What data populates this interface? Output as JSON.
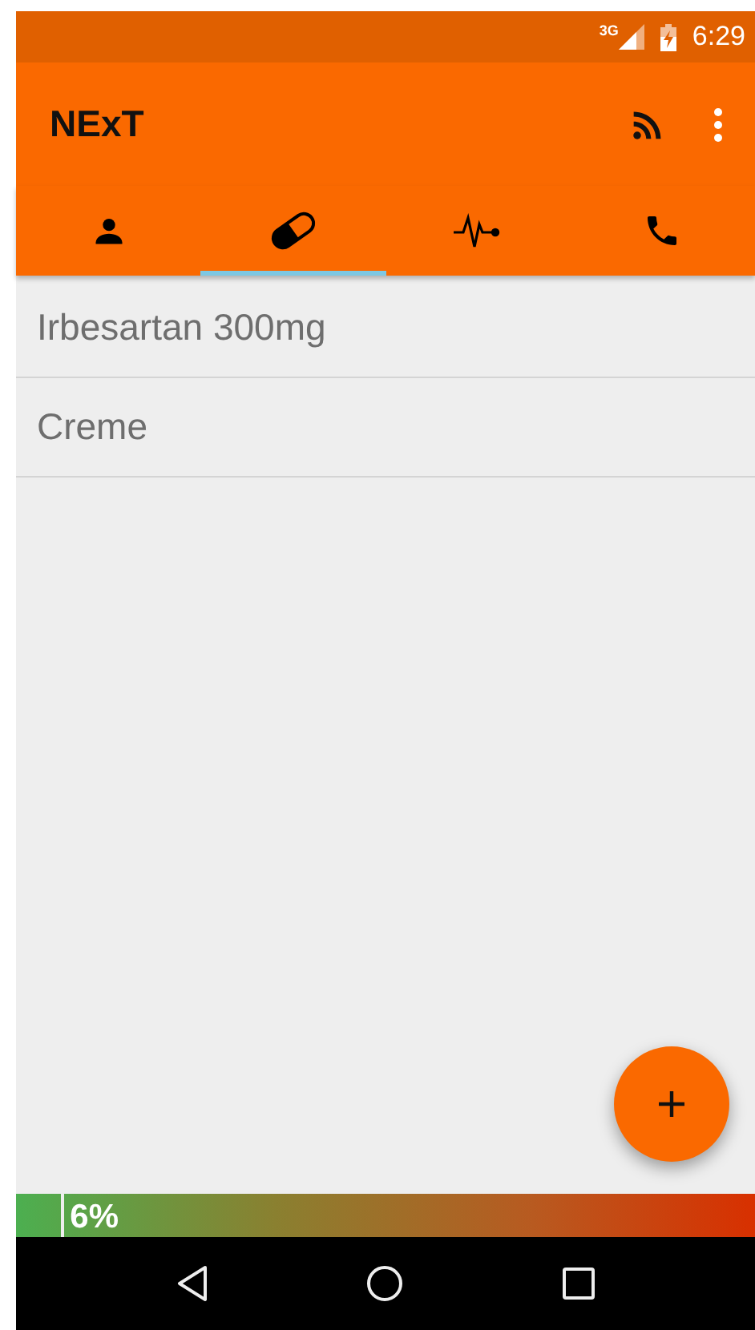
{
  "status_bar": {
    "network": "3G",
    "time": "6:29"
  },
  "toolbar": {
    "title": "NExT"
  },
  "tabs": [
    {
      "kind": "person",
      "selected": false
    },
    {
      "kind": "pill",
      "selected": true
    },
    {
      "kind": "pulse",
      "selected": false
    },
    {
      "kind": "phone",
      "selected": false
    }
  ],
  "list": [
    {
      "label": "Irbesartan 300mg"
    },
    {
      "label": "Creme"
    }
  ],
  "meter": {
    "level": 0.06,
    "reading": "6%"
  }
}
